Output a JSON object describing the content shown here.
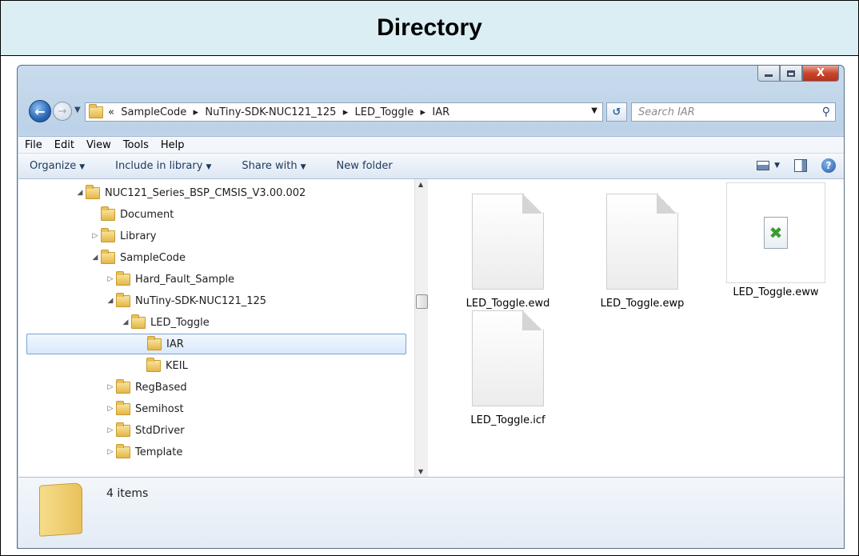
{
  "header": {
    "title": "Directory"
  },
  "window": {
    "minimize": "",
    "maximize": "",
    "close": "X"
  },
  "nav": {
    "address_prefix": "«",
    "path": [
      "SampleCode",
      "NuTiny-SDK-NUC121_125",
      "LED_Toggle",
      "IAR"
    ],
    "search_placeholder": "Search IAR"
  },
  "menu": [
    "File",
    "Edit",
    "View",
    "Tools",
    "Help"
  ],
  "commands": {
    "organize": "Organize",
    "include": "Include in library",
    "share": "Share with",
    "newfolder": "New folder"
  },
  "tree": [
    {
      "label": "NUC121_Series_BSP_CMSIS_V3.00.002",
      "level": 0,
      "expander": "open"
    },
    {
      "label": "Document",
      "level": 1,
      "expander": "none"
    },
    {
      "label": "Library",
      "level": 1,
      "expander": "closed"
    },
    {
      "label": "SampleCode",
      "level": 1,
      "expander": "open"
    },
    {
      "label": "Hard_Fault_Sample",
      "level": 2,
      "expander": "closed"
    },
    {
      "label": "NuTiny-SDK-NUC121_125",
      "level": 2,
      "expander": "open"
    },
    {
      "label": "LED_Toggle",
      "level": 3,
      "expander": "open"
    },
    {
      "label": "IAR",
      "level": 4,
      "expander": "none",
      "selected": true
    },
    {
      "label": "KEIL",
      "level": 4,
      "expander": "none"
    },
    {
      "label": "RegBased",
      "level": 2,
      "expander": "closed"
    },
    {
      "label": "Semihost",
      "level": 2,
      "expander": "closed"
    },
    {
      "label": "StdDriver",
      "level": 2,
      "expander": "closed"
    },
    {
      "label": "Template",
      "level": 2,
      "expander": "closed"
    }
  ],
  "files": [
    {
      "name": "LED_Toggle.ewd",
      "kind": "doc"
    },
    {
      "name": "LED_Toggle.ewp",
      "kind": "doc"
    },
    {
      "name": "LED_Toggle.eww",
      "kind": "workspace"
    },
    {
      "name": "LED_Toggle.icf",
      "kind": "doc"
    }
  ],
  "details": {
    "count": "4 items"
  }
}
